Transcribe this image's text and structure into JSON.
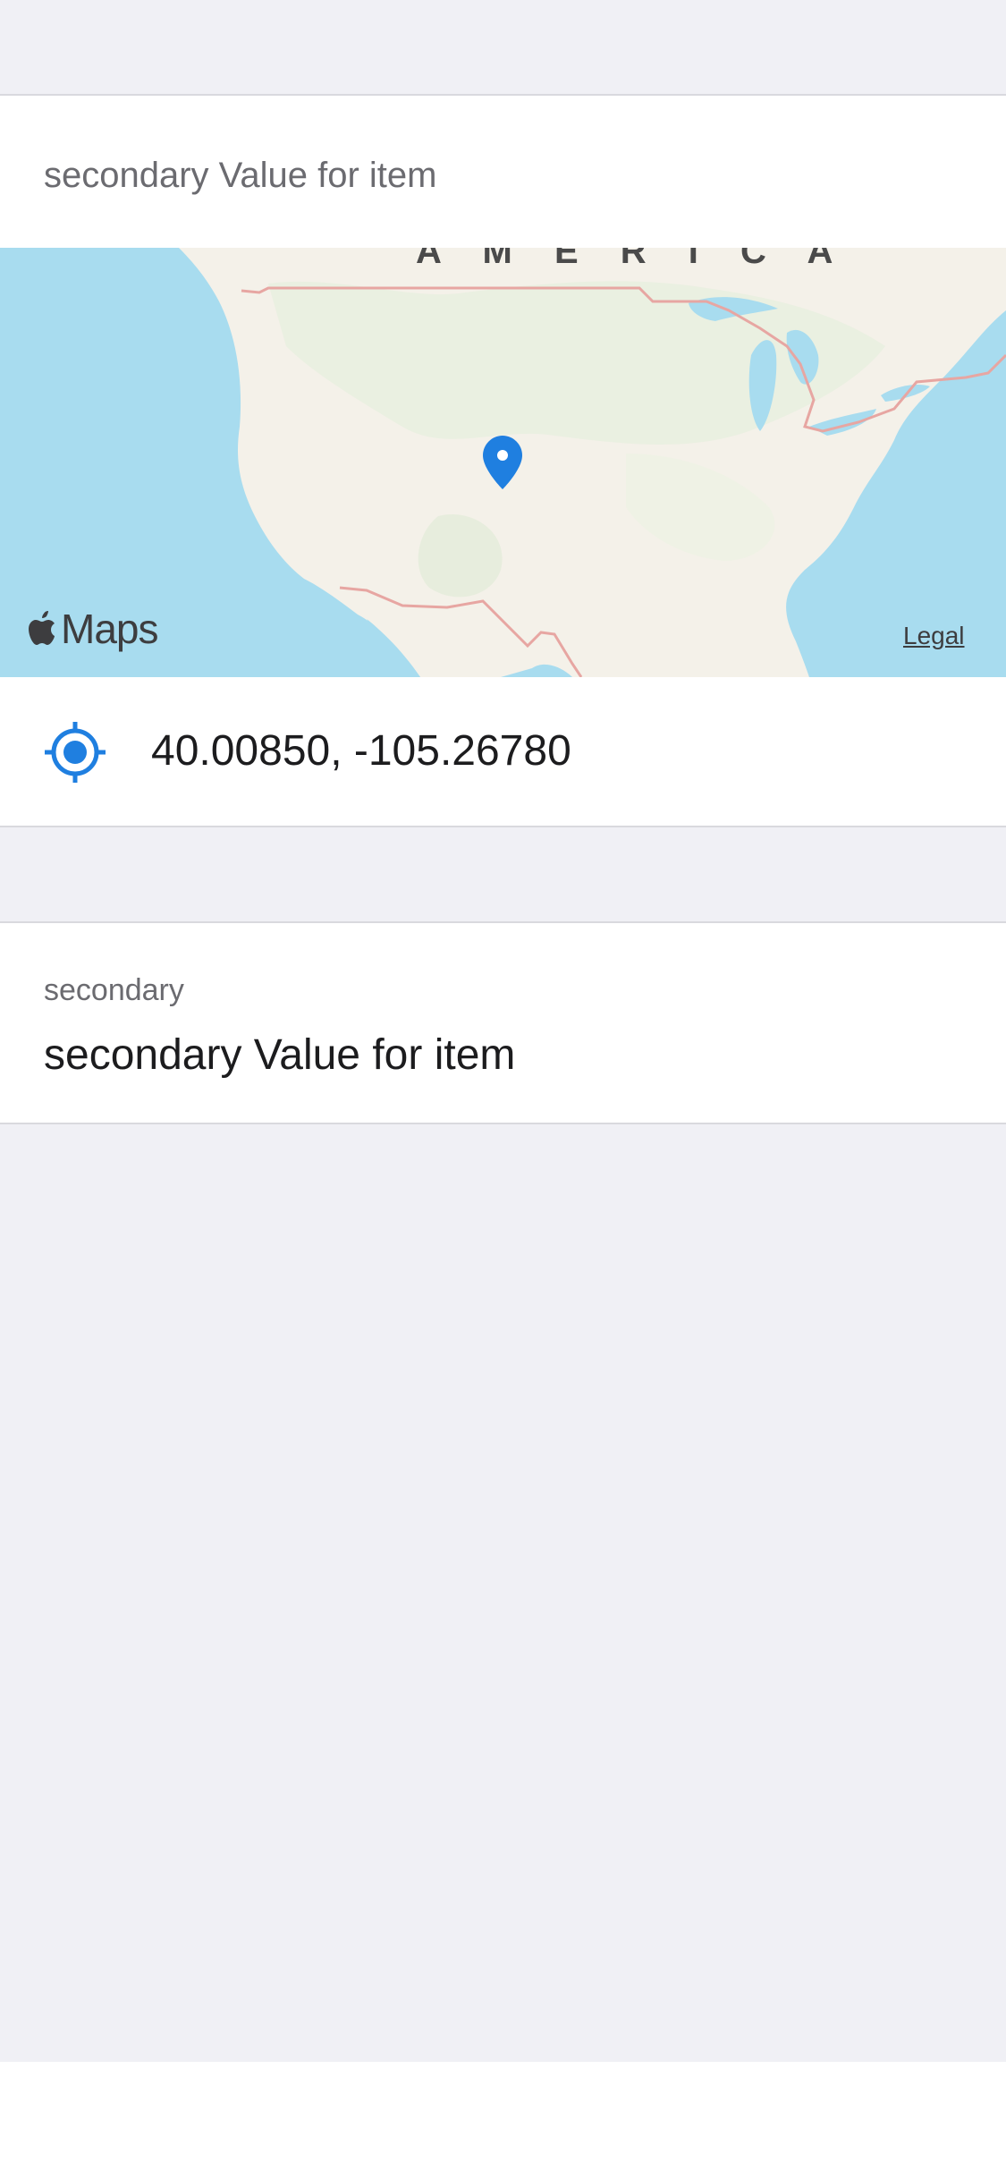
{
  "location_section": {
    "header": "secondary Value for item"
  },
  "map": {
    "region_label": "A M E R I C A",
    "brand": "Maps",
    "legal": "Legal",
    "pin_icon": "map-pin-icon"
  },
  "coordinates": {
    "value": "40.00850, -105.26780",
    "icon": "location-target-icon"
  },
  "detail_field": {
    "label": "secondary",
    "value": "secondary Value for item"
  },
  "colors": {
    "accent": "#1f7fe0",
    "background": "#f0f0f5",
    "water": "#a8dcef",
    "land": "#f4f1e9"
  }
}
